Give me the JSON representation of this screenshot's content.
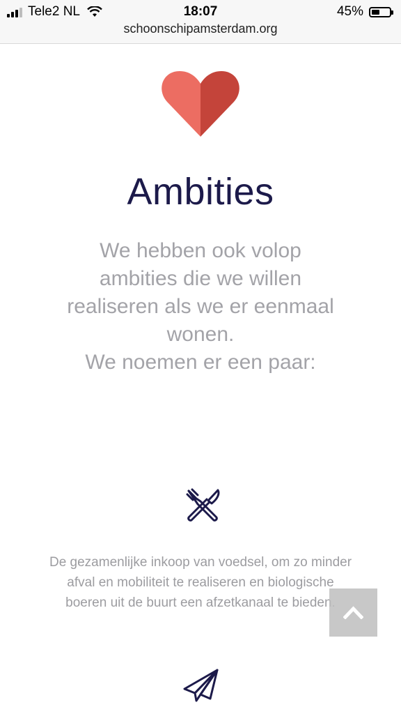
{
  "status_bar": {
    "carrier": "Tele2 NL",
    "time": "18:07",
    "battery_percent": "45%",
    "battery_level": 0.45,
    "signal_bars_active": 3,
    "signal_bars_total": 4
  },
  "browser": {
    "url": "schoonschipamsterdam.org"
  },
  "section": {
    "heart_colors": {
      "left": "#ec6d62",
      "right": "#c4443a"
    },
    "title": "Ambities",
    "intro_lines": [
      "We hebben ook volop",
      "ambities die we willen",
      "realiseren als we er eenmaal",
      "wonen.",
      "We noemen er een paar:"
    ]
  },
  "items": [
    {
      "icon": "cutlery-icon",
      "description_lines": [
        "De gezamenlijke inkoop van voedsel, om zo minder",
        "afval en mobiliteit te realiseren en biologische",
        "boeren uit de buurt een afzetkanaal te bieden."
      ]
    },
    {
      "icon": "paper-plane-icon"
    }
  ],
  "scroll_top_button": {
    "icon": "chevron-up-icon"
  },
  "colors": {
    "title": "#1c1a4a",
    "text": "#a3a3a8",
    "icon": "#1c1a4a"
  }
}
